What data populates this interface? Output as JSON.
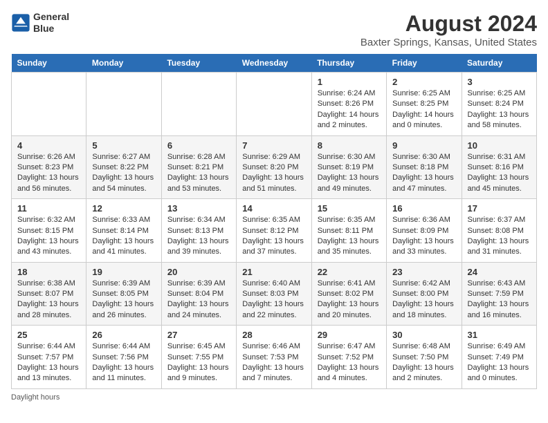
{
  "header": {
    "logo_line1": "General",
    "logo_line2": "Blue",
    "title": "August 2024",
    "subtitle": "Baxter Springs, Kansas, United States"
  },
  "weekdays": [
    "Sunday",
    "Monday",
    "Tuesday",
    "Wednesday",
    "Thursday",
    "Friday",
    "Saturday"
  ],
  "weeks": [
    [
      {
        "day": "",
        "info": ""
      },
      {
        "day": "",
        "info": ""
      },
      {
        "day": "",
        "info": ""
      },
      {
        "day": "",
        "info": ""
      },
      {
        "day": "1",
        "info": "Sunrise: 6:24 AM\nSunset: 8:26 PM\nDaylight: 14 hours\nand 2 minutes."
      },
      {
        "day": "2",
        "info": "Sunrise: 6:25 AM\nSunset: 8:25 PM\nDaylight: 14 hours\nand 0 minutes."
      },
      {
        "day": "3",
        "info": "Sunrise: 6:25 AM\nSunset: 8:24 PM\nDaylight: 13 hours\nand 58 minutes."
      }
    ],
    [
      {
        "day": "4",
        "info": "Sunrise: 6:26 AM\nSunset: 8:23 PM\nDaylight: 13 hours\nand 56 minutes."
      },
      {
        "day": "5",
        "info": "Sunrise: 6:27 AM\nSunset: 8:22 PM\nDaylight: 13 hours\nand 54 minutes."
      },
      {
        "day": "6",
        "info": "Sunrise: 6:28 AM\nSunset: 8:21 PM\nDaylight: 13 hours\nand 53 minutes."
      },
      {
        "day": "7",
        "info": "Sunrise: 6:29 AM\nSunset: 8:20 PM\nDaylight: 13 hours\nand 51 minutes."
      },
      {
        "day": "8",
        "info": "Sunrise: 6:30 AM\nSunset: 8:19 PM\nDaylight: 13 hours\nand 49 minutes."
      },
      {
        "day": "9",
        "info": "Sunrise: 6:30 AM\nSunset: 8:18 PM\nDaylight: 13 hours\nand 47 minutes."
      },
      {
        "day": "10",
        "info": "Sunrise: 6:31 AM\nSunset: 8:16 PM\nDaylight: 13 hours\nand 45 minutes."
      }
    ],
    [
      {
        "day": "11",
        "info": "Sunrise: 6:32 AM\nSunset: 8:15 PM\nDaylight: 13 hours\nand 43 minutes."
      },
      {
        "day": "12",
        "info": "Sunrise: 6:33 AM\nSunset: 8:14 PM\nDaylight: 13 hours\nand 41 minutes."
      },
      {
        "day": "13",
        "info": "Sunrise: 6:34 AM\nSunset: 8:13 PM\nDaylight: 13 hours\nand 39 minutes."
      },
      {
        "day": "14",
        "info": "Sunrise: 6:35 AM\nSunset: 8:12 PM\nDaylight: 13 hours\nand 37 minutes."
      },
      {
        "day": "15",
        "info": "Sunrise: 6:35 AM\nSunset: 8:11 PM\nDaylight: 13 hours\nand 35 minutes."
      },
      {
        "day": "16",
        "info": "Sunrise: 6:36 AM\nSunset: 8:09 PM\nDaylight: 13 hours\nand 33 minutes."
      },
      {
        "day": "17",
        "info": "Sunrise: 6:37 AM\nSunset: 8:08 PM\nDaylight: 13 hours\nand 31 minutes."
      }
    ],
    [
      {
        "day": "18",
        "info": "Sunrise: 6:38 AM\nSunset: 8:07 PM\nDaylight: 13 hours\nand 28 minutes."
      },
      {
        "day": "19",
        "info": "Sunrise: 6:39 AM\nSunset: 8:05 PM\nDaylight: 13 hours\nand 26 minutes."
      },
      {
        "day": "20",
        "info": "Sunrise: 6:39 AM\nSunset: 8:04 PM\nDaylight: 13 hours\nand 24 minutes."
      },
      {
        "day": "21",
        "info": "Sunrise: 6:40 AM\nSunset: 8:03 PM\nDaylight: 13 hours\nand 22 minutes."
      },
      {
        "day": "22",
        "info": "Sunrise: 6:41 AM\nSunset: 8:02 PM\nDaylight: 13 hours\nand 20 minutes."
      },
      {
        "day": "23",
        "info": "Sunrise: 6:42 AM\nSunset: 8:00 PM\nDaylight: 13 hours\nand 18 minutes."
      },
      {
        "day": "24",
        "info": "Sunrise: 6:43 AM\nSunset: 7:59 PM\nDaylight: 13 hours\nand 16 minutes."
      }
    ],
    [
      {
        "day": "25",
        "info": "Sunrise: 6:44 AM\nSunset: 7:57 PM\nDaylight: 13 hours\nand 13 minutes."
      },
      {
        "day": "26",
        "info": "Sunrise: 6:44 AM\nSunset: 7:56 PM\nDaylight: 13 hours\nand 11 minutes."
      },
      {
        "day": "27",
        "info": "Sunrise: 6:45 AM\nSunset: 7:55 PM\nDaylight: 13 hours\nand 9 minutes."
      },
      {
        "day": "28",
        "info": "Sunrise: 6:46 AM\nSunset: 7:53 PM\nDaylight: 13 hours\nand 7 minutes."
      },
      {
        "day": "29",
        "info": "Sunrise: 6:47 AM\nSunset: 7:52 PM\nDaylight: 13 hours\nand 4 minutes."
      },
      {
        "day": "30",
        "info": "Sunrise: 6:48 AM\nSunset: 7:50 PM\nDaylight: 13 hours\nand 2 minutes."
      },
      {
        "day": "31",
        "info": "Sunrise: 6:49 AM\nSunset: 7:49 PM\nDaylight: 13 hours\nand 0 minutes."
      }
    ]
  ],
  "footer": "Daylight hours"
}
